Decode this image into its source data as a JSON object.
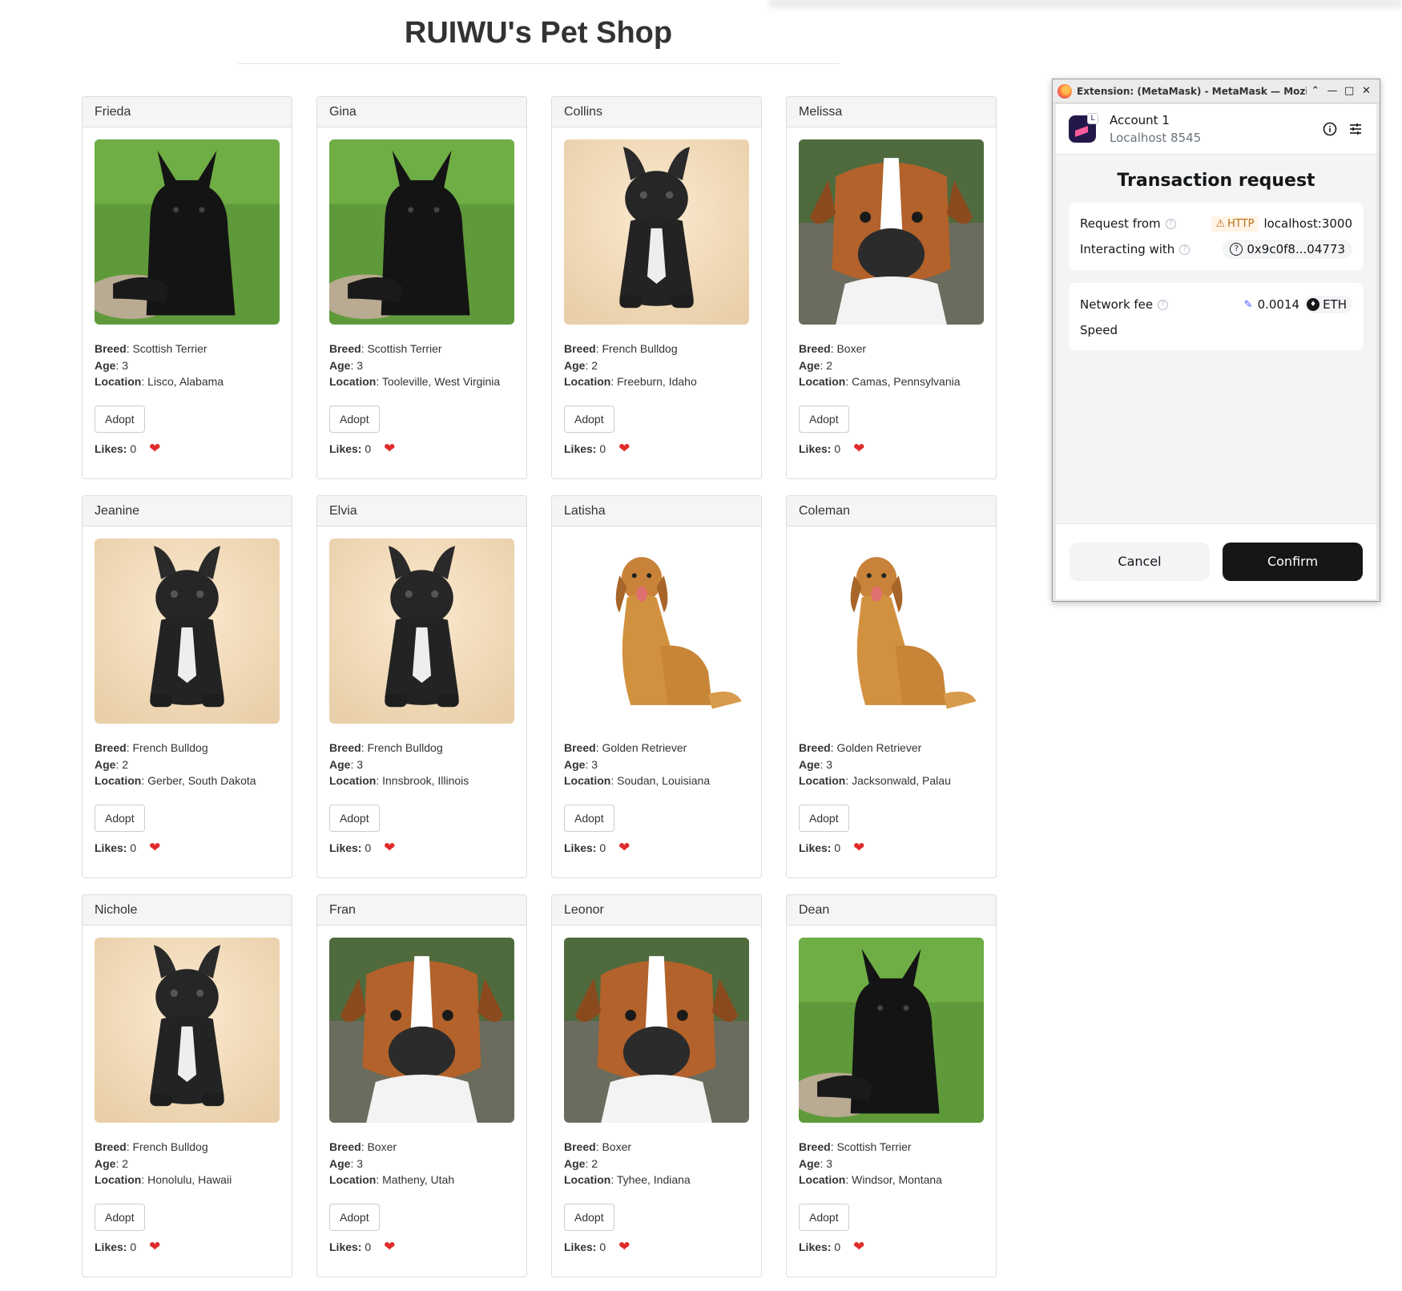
{
  "page": {
    "title": "RUIWU's Pet Shop"
  },
  "labels": {
    "breed": "Breed",
    "age": "Age",
    "location": "Location",
    "adopt": "Adopt",
    "likes": "Likes:"
  },
  "pets": [
    {
      "name": "Frieda",
      "breed": "Scottish Terrier",
      "age": "3",
      "location": "Lisco, Alabama",
      "likes": "0",
      "photo": "scottish-terrier-photo"
    },
    {
      "name": "Gina",
      "breed": "Scottish Terrier",
      "age": "3",
      "location": "Tooleville, West Virginia",
      "likes": "0",
      "photo": "scottish-terrier-photo"
    },
    {
      "name": "Collins",
      "breed": "French Bulldog",
      "age": "2",
      "location": "Freeburn, Idaho",
      "likes": "0",
      "photo": "french-bulldog-photo"
    },
    {
      "name": "Melissa",
      "breed": "Boxer",
      "age": "2",
      "location": "Camas, Pennsylvania",
      "likes": "0",
      "photo": "boxer-photo"
    },
    {
      "name": "Jeanine",
      "breed": "French Bulldog",
      "age": "2",
      "location": "Gerber, South Dakota",
      "likes": "0",
      "photo": "french-bulldog-photo"
    },
    {
      "name": "Elvia",
      "breed": "French Bulldog",
      "age": "3",
      "location": "Innsbrook, Illinois",
      "likes": "0",
      "photo": "french-bulldog-photo"
    },
    {
      "name": "Latisha",
      "breed": "Golden Retriever",
      "age": "3",
      "location": "Soudan, Louisiana",
      "likes": "0",
      "photo": "golden-retriever-photo"
    },
    {
      "name": "Coleman",
      "breed": "Golden Retriever",
      "age": "3",
      "location": "Jacksonwald, Palau",
      "likes": "0",
      "photo": "golden-retriever-photo"
    },
    {
      "name": "Nichole",
      "breed": "French Bulldog",
      "age": "2",
      "location": "Honolulu, Hawaii",
      "likes": "0",
      "photo": "french-bulldog-photo"
    },
    {
      "name": "Fran",
      "breed": "Boxer",
      "age": "3",
      "location": "Matheny, Utah",
      "likes": "0",
      "photo": "boxer-photo"
    },
    {
      "name": "Leonor",
      "breed": "Boxer",
      "age": "2",
      "location": "Tyhee, Indiana",
      "likes": "0",
      "photo": "boxer-photo"
    },
    {
      "name": "Dean",
      "breed": "Scottish Terrier",
      "age": "3",
      "location": "Windsor, Montana",
      "likes": "0",
      "photo": "scottish-terrier-photo"
    }
  ],
  "metamask": {
    "window_title": "Extension: (MetaMask) - MetaMask — Mozilla Fi",
    "account_name": "Account 1",
    "network": "Localhost 8545",
    "badge_letter": "L",
    "heading": "Transaction request",
    "request_from_label": "Request from",
    "http_badge": "HTTP",
    "request_from_value": "localhost:3000",
    "interacting_with_label": "Interacting with",
    "interacting_with_value": "0x9c0f8...04773",
    "network_fee_label": "Network fee",
    "network_fee_value": "0.0014",
    "fee_currency": "ETH",
    "speed_label": "Speed",
    "cancel_label": "Cancel",
    "confirm_label": "Confirm"
  },
  "colors": {
    "heart": "#e02b2b",
    "confirm_bg": "#141618",
    "http_badge": "#b8731a",
    "link_blue": "#4459ff"
  }
}
